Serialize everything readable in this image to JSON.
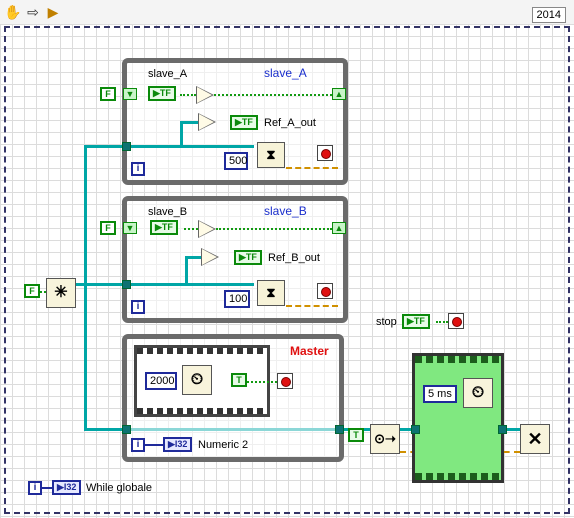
{
  "toolbar": {
    "icons": [
      "hand-icon",
      "arrow-icon",
      "run-icon"
    ],
    "version": "2014"
  },
  "loops": {
    "slave_a": {
      "title": "slave_A",
      "local_var": "slave_A",
      "ref_label": "Ref_A_out",
      "wait_ms": "500",
      "iteration": "i"
    },
    "slave_b": {
      "title": "slave_B",
      "local_var": "slave_B",
      "ref_label": "Ref_B_out",
      "wait_ms": "100",
      "iteration": "i"
    },
    "master": {
      "title": "Master",
      "wait_ms": "2000",
      "iteration": "i",
      "numeric_label": "Numeric 2"
    }
  },
  "constants": {
    "false": "F",
    "true": "T",
    "tf": "TF",
    "i32": "I32"
  },
  "stop_label": "stop",
  "timed_loop": {
    "period": "5 ms"
  },
  "global": {
    "iteration": "i",
    "label": "While globale"
  },
  "colors": {
    "loop_border": "#6b6b6b",
    "boolean_wire": "#129a12",
    "refnum_wire": "#00a6a6",
    "integer_wire": "#1f2a9a",
    "error_wire": "#d09000",
    "title_blue": "#1a2ecc",
    "title_red": "#e01010",
    "timed_loop_fill": "#80e880"
  }
}
